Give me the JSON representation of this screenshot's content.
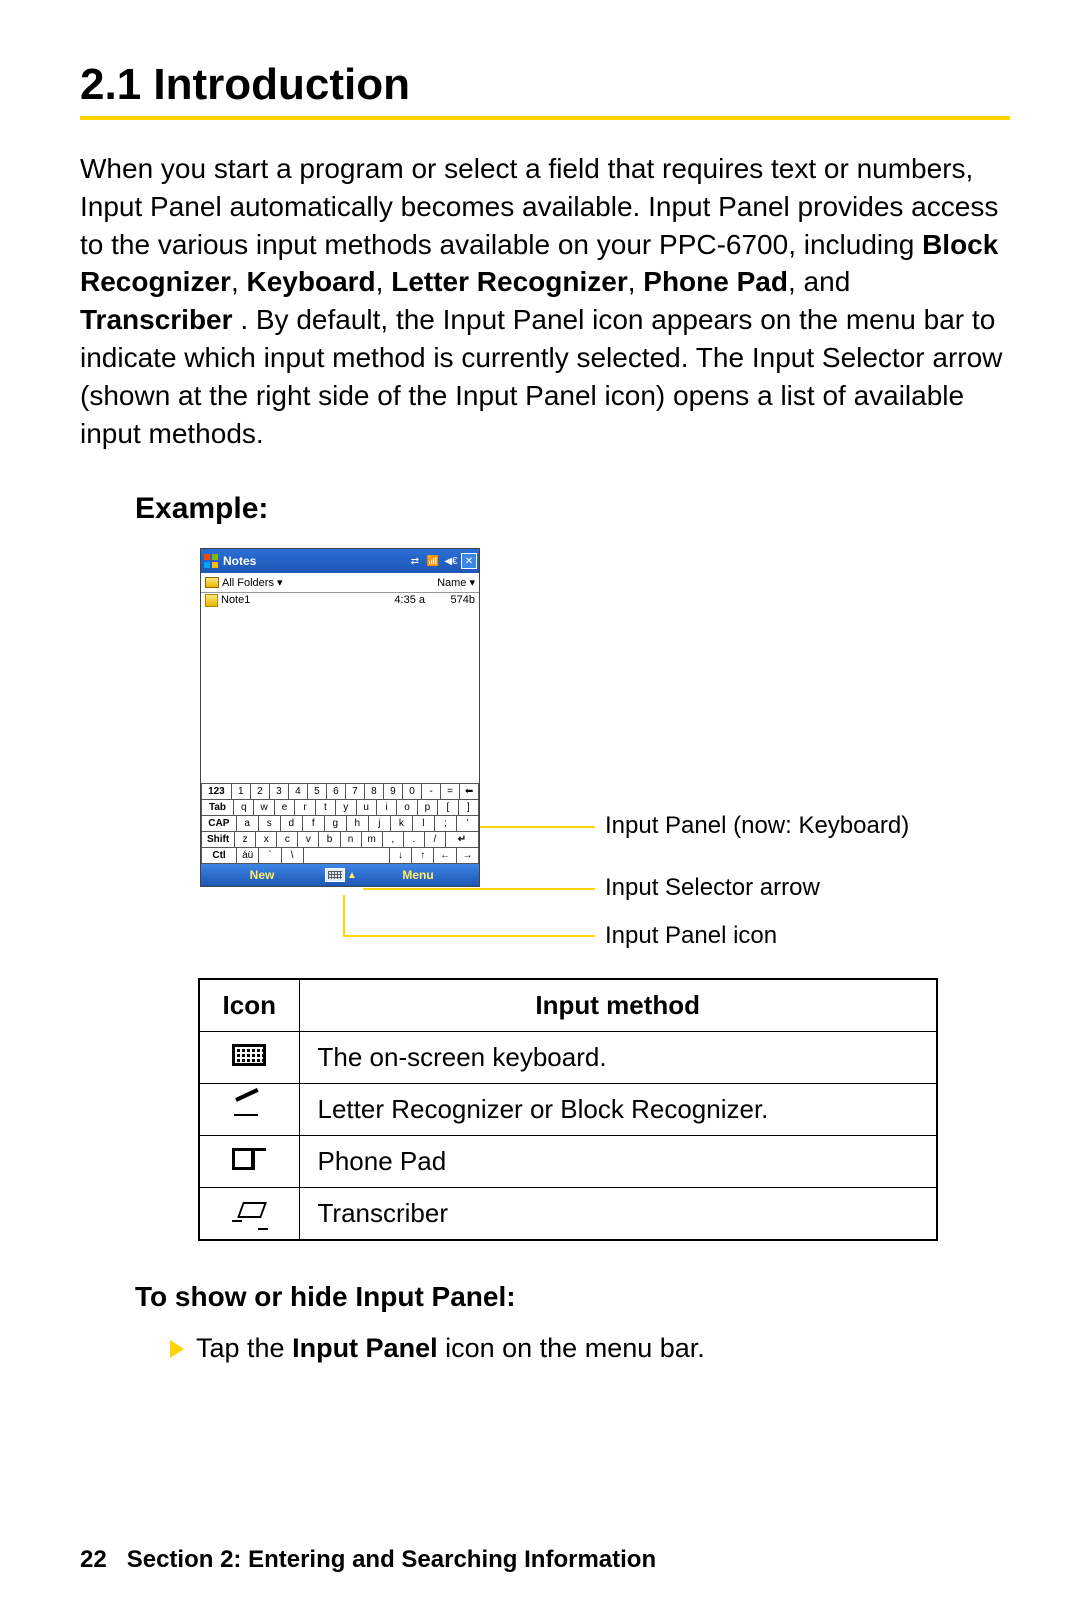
{
  "heading": "2.1   Introduction",
  "paragraph": {
    "p1": "When you start a program or select a field that requires text or numbers, Input Panel automatically becomes available. Input Panel provides access to the various input methods available on your PPC-6700, including ",
    "b1": "Block Recognizer",
    "c1": ", ",
    "b2": "Keyboard",
    "c2": ", ",
    "b3": "Letter Recognizer",
    "c3": ", ",
    "b4": "Phone Pad",
    "c4": ", and ",
    "b5": "Transcriber",
    "p2": ". By default, the Input Panel icon appears on the menu bar to indicate which input method is currently selected. The Input Selector arrow (shown at the right side of the Input Panel icon) opens a list of available input methods."
  },
  "example_label": "Example:",
  "device": {
    "title": "Notes",
    "folders_label": "All Folders",
    "sort_label": "Name",
    "note_row": {
      "name": "Note1",
      "time": "4:35 a",
      "size": "574b"
    },
    "kbd_rows": {
      "r1": [
        "123",
        "1",
        "2",
        "3",
        "4",
        "5",
        "6",
        "7",
        "8",
        "9",
        "0",
        "-",
        "=",
        "⬅"
      ],
      "r2": [
        "Tab",
        "q",
        "w",
        "e",
        "r",
        "t",
        "y",
        "u",
        "i",
        "o",
        "p",
        "[",
        "]"
      ],
      "r3": [
        "CAP",
        "a",
        "s",
        "d",
        "f",
        "g",
        "h",
        "j",
        "k",
        "l",
        ";",
        "'"
      ],
      "r4": [
        "Shift",
        "z",
        "x",
        "c",
        "v",
        "b",
        "n",
        "m",
        ",",
        ".",
        "/",
        "↵"
      ],
      "r5": [
        "Ctl",
        "áü",
        "`",
        "\\",
        "",
        "",
        "",
        "",
        "",
        "↓",
        "↑",
        "←",
        "→"
      ]
    },
    "menu_new": "New",
    "menu_menu": "Menu"
  },
  "annotations": {
    "a1": "Input Panel (now: Keyboard)",
    "a2": "Input Selector arrow",
    "a3": "Input Panel icon"
  },
  "table": {
    "header_icon": "Icon",
    "header_method": "Input method",
    "rows": [
      {
        "method": "The on-screen keyboard."
      },
      {
        "method": "Letter Recognizer or Block Recognizer."
      },
      {
        "method": "Phone Pad"
      },
      {
        "method": "Transcriber"
      }
    ]
  },
  "subhead": "To show or hide Input Panel:",
  "step": {
    "pre": "Tap the ",
    "bold": "Input Panel",
    "post": " icon on the menu bar."
  },
  "footer": {
    "page": "22",
    "section": "Section 2: Entering and Searching Information"
  }
}
